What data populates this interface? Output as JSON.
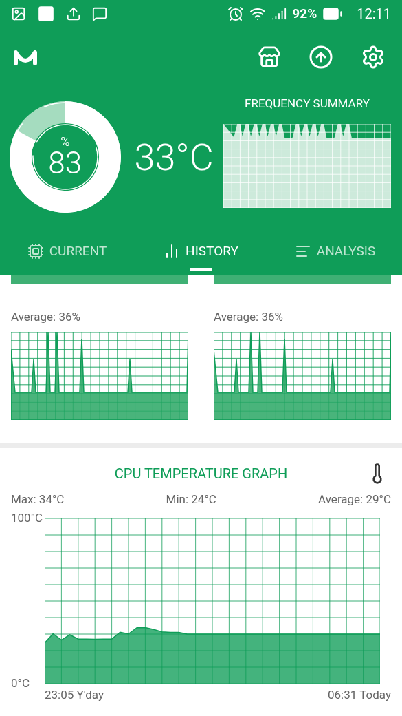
{
  "status_bar": {
    "battery": "92%",
    "time": "12:11"
  },
  "gauge": {
    "unit": "%",
    "value": "83"
  },
  "temperature": "33°C",
  "frequency_summary": {
    "title": "FREQUENCY SUMMARY"
  },
  "tabs": [
    {
      "label": "CURRENT",
      "kind": "cpu",
      "selected": false
    },
    {
      "label": "HISTORY",
      "kind": "bars",
      "selected": true
    },
    {
      "label": "ANALYSIS",
      "kind": "lines",
      "selected": false
    }
  ],
  "cores": [
    {
      "average": "Average: 36%"
    },
    {
      "average": "Average: 36%"
    }
  ],
  "temperature_card": {
    "title": "CPU TEMPERATURE GRAPH",
    "start_time": "23:05 Y'day",
    "end_time": "06:31 Today",
    "max": "Max: 34°C",
    "min": "Min: 24°C",
    "average": "Average: 29°C",
    "chart_data": {
      "type": "area",
      "categories": [
        null,
        null,
        null,
        null,
        null,
        null,
        null,
        null,
        null,
        null,
        null,
        null,
        null,
        null,
        null,
        null,
        null,
        null,
        null,
        null,
        null,
        null,
        null,
        null,
        null,
        null,
        null,
        null,
        null,
        null,
        null,
        null,
        null,
        null,
        null,
        null,
        null,
        null,
        null,
        null,
        null
      ],
      "series": [
        {
          "color": "#0f9d58",
          "values": [
            24.6,
            30.2,
            26.4,
            29.6,
            27,
            27,
            26.9,
            27,
            27,
            31.1,
            30.1,
            33.9,
            34,
            32.8,
            31.4,
            31,
            31,
            30,
            30,
            30,
            30,
            30,
            30,
            30,
            30,
            30,
            30,
            30,
            30,
            30,
            30,
            30,
            30,
            30,
            30,
            30,
            30,
            30,
            30,
            30,
            30
          ]
        }
      ],
      "ylim": [
        0,
        100
      ],
      "grid": true,
      "yticks": [
        {
          "value": 0,
          "label": "0°C"
        },
        {
          "value": 100,
          "label": "100°C"
        }
      ]
    }
  }
}
